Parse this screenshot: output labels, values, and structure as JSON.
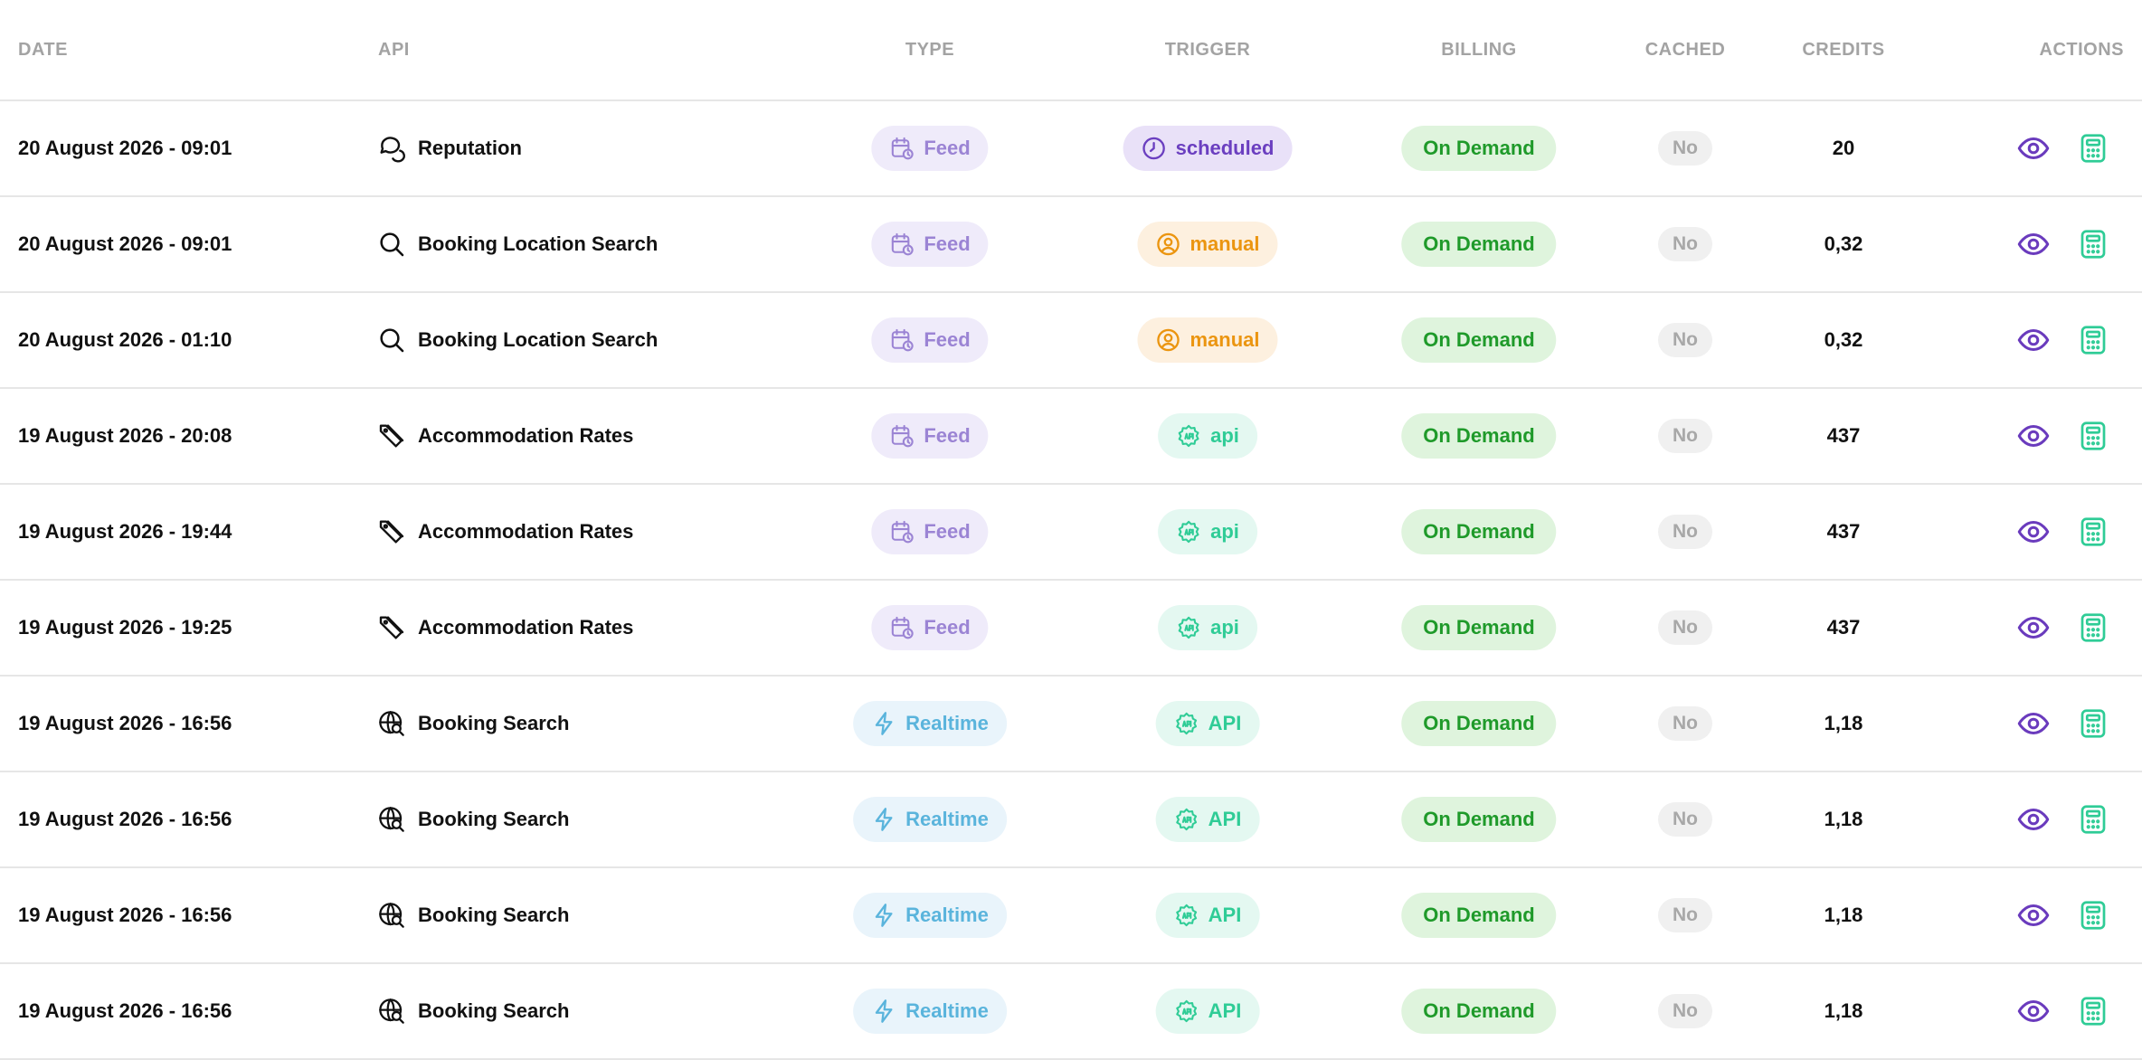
{
  "colors": {
    "header_text": "#a3a3a3",
    "feed": "#9b84d4",
    "realtime": "#5ab4dc",
    "scheduled": "#6b3fc0",
    "manual": "#eb9510",
    "api": "#2fcc96",
    "billing": "#1f9a2a",
    "view_icon": "#6a3bbd",
    "invoice_icon": "#2fcc96"
  },
  "header": {
    "date": "DATE",
    "api": "API",
    "type": "TYPE",
    "trigger": "TRIGGER",
    "billing": "BILLING",
    "cached": "CACHED",
    "credits": "CREDITS",
    "actions": "ACTIONS"
  },
  "rows": [
    {
      "date": "20 August 2026 - 09:01",
      "api": "Reputation",
      "api_icon": "chat-bubbles-icon",
      "type": "Feed",
      "trigger": "scheduled",
      "billing": "On Demand",
      "cached": "No",
      "credits": "20"
    },
    {
      "date": "20 August 2026 - 09:01",
      "api": "Booking Location Search",
      "api_icon": "search-icon",
      "type": "Feed",
      "trigger": "manual",
      "billing": "On Demand",
      "cached": "No",
      "credits": "0,32"
    },
    {
      "date": "20 August 2026 - 01:10",
      "api": "Booking Location Search",
      "api_icon": "search-icon",
      "type": "Feed",
      "trigger": "manual",
      "billing": "On Demand",
      "cached": "No",
      "credits": "0,32"
    },
    {
      "date": "19 August 2026 - 20:08",
      "api": "Accommodation Rates",
      "api_icon": "price-tag-icon",
      "type": "Feed",
      "trigger": "api",
      "billing": "On Demand",
      "cached": "No",
      "credits": "437"
    },
    {
      "date": "19 August 2026 - 19:44",
      "api": "Accommodation Rates",
      "api_icon": "price-tag-icon",
      "type": "Feed",
      "trigger": "api",
      "billing": "On Demand",
      "cached": "No",
      "credits": "437"
    },
    {
      "date": "19 August 2026 - 19:25",
      "api": "Accommodation Rates",
      "api_icon": "price-tag-icon",
      "type": "Feed",
      "trigger": "api",
      "billing": "On Demand",
      "cached": "No",
      "credits": "437"
    },
    {
      "date": "19 August 2026 - 16:56",
      "api": "Booking Search",
      "api_icon": "globe-search-icon",
      "type": "Realtime",
      "trigger": "API",
      "billing": "On Demand",
      "cached": "No",
      "credits": "1,18"
    },
    {
      "date": "19 August 2026 - 16:56",
      "api": "Booking Search",
      "api_icon": "globe-search-icon",
      "type": "Realtime",
      "trigger": "API",
      "billing": "On Demand",
      "cached": "No",
      "credits": "1,18"
    },
    {
      "date": "19 August 2026 - 16:56",
      "api": "Booking Search",
      "api_icon": "globe-search-icon",
      "type": "Realtime",
      "trigger": "API",
      "billing": "On Demand",
      "cached": "No",
      "credits": "1,18"
    },
    {
      "date": "19 August 2026 - 16:56",
      "api": "Booking Search",
      "api_icon": "globe-search-icon",
      "type": "Realtime",
      "trigger": "API",
      "billing": "On Demand",
      "cached": "No",
      "credits": "1,18"
    }
  ]
}
